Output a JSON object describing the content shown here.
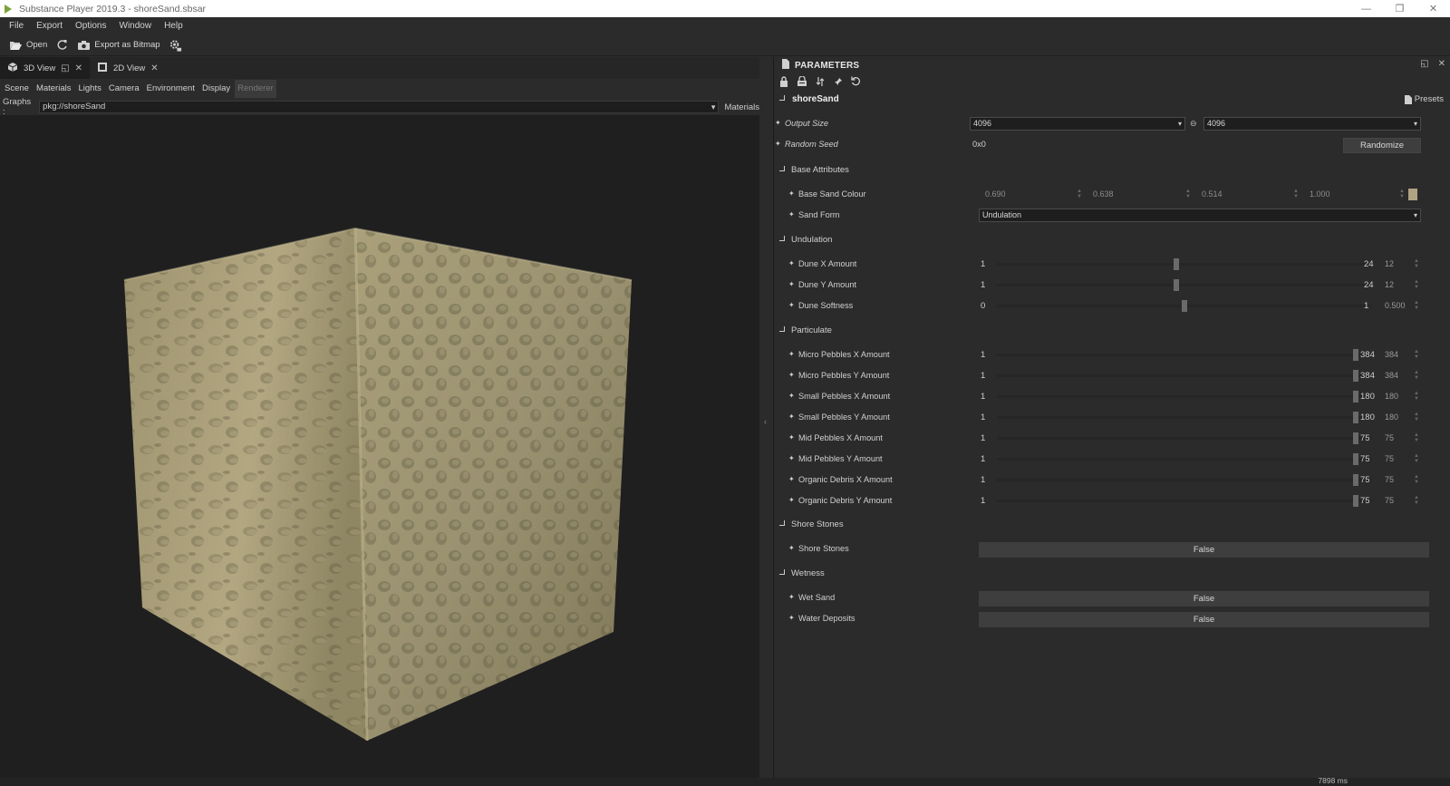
{
  "window": {
    "title": "Substance Player 2019.3 - shoreSand.sbsar",
    "controls": [
      "—",
      "❐",
      "✕"
    ]
  },
  "menu": [
    "File",
    "Export",
    "Options",
    "Window",
    "Help"
  ],
  "toolbar": {
    "open_label": "Open",
    "export_label": "Export as Bitmap"
  },
  "view_tabs": [
    {
      "label": "3D View"
    },
    {
      "label": "2D View"
    }
  ],
  "view_menu": [
    "Scene",
    "Materials",
    "Lights",
    "Camera",
    "Environment",
    "Display",
    "Renderer"
  ],
  "graphs": {
    "label": "Graphs :",
    "value": "pkg://shoreSand",
    "materials_label": "Materials"
  },
  "parameters": {
    "title": "PARAMETERS",
    "graph_name": "shoreSand",
    "presets_label": "Presets",
    "output_size": {
      "label": "Output Size",
      "width": "4096",
      "height": "4096"
    },
    "random_seed": {
      "label": "Random Seed",
      "value": "0x0",
      "button": "Randomize"
    },
    "sections": {
      "base_attributes": "Base Attributes",
      "undulation": "Undulation",
      "particulate": "Particulate",
      "shore_stones": "Shore Stones",
      "wetness": "Wetness"
    },
    "base_sand_colour": {
      "label": "Base Sand Colour",
      "values": [
        "0.690",
        "0.638",
        "0.514",
        "1.000"
      ],
      "swatch": "#b0a383"
    },
    "sand_form": {
      "label": "Sand Form",
      "value": "Undulation"
    },
    "undulation_params": [
      {
        "label": "Dune X Amount",
        "min": "1",
        "max": "24",
        "value": "12",
        "fraction": 0.478
      },
      {
        "label": "Dune Y Amount",
        "min": "1",
        "max": "24",
        "value": "12",
        "fraction": 0.478
      },
      {
        "label": "Dune Softness",
        "min": "0",
        "max": "1",
        "value": "0.500",
        "fraction": 0.5
      }
    ],
    "particulate_params": [
      {
        "label": "Micro Pebbles X Amount",
        "min": "1",
        "max": "384",
        "value": "384",
        "fraction": 1.0
      },
      {
        "label": "Micro Pebbles Y Amount",
        "min": "1",
        "max": "384",
        "value": "384",
        "fraction": 1.0
      },
      {
        "label": "Small Pebbles X Amount",
        "min": "1",
        "max": "180",
        "value": "180",
        "fraction": 1.0
      },
      {
        "label": "Small Pebbles Y Amount",
        "min": "1",
        "max": "180",
        "value": "180",
        "fraction": 1.0
      },
      {
        "label": "Mid Pebbles X Amount",
        "min": "1",
        "max": "75",
        "value": "75",
        "fraction": 1.0
      },
      {
        "label": "Mid Pebbles Y Amount",
        "min": "1",
        "max": "75",
        "value": "75",
        "fraction": 1.0
      },
      {
        "label": "Organic Debris X Amount",
        "min": "1",
        "max": "75",
        "value": "75",
        "fraction": 1.0
      },
      {
        "label": "Organic Debris Y Amount",
        "min": "1",
        "max": "75",
        "value": "75",
        "fraction": 1.0
      }
    ],
    "shore_stones": {
      "label": "Shore Stones",
      "value": "False"
    },
    "wet_sand": {
      "label": "Wet Sand",
      "value": "False"
    },
    "water_deposits": {
      "label": "Water Deposits",
      "value": "False"
    }
  },
  "status": {
    "render_time": "7898 ms"
  },
  "colors": {
    "background": "#2b2b2b",
    "viewport": "#1f1f1f",
    "sand": "#b0a383"
  }
}
